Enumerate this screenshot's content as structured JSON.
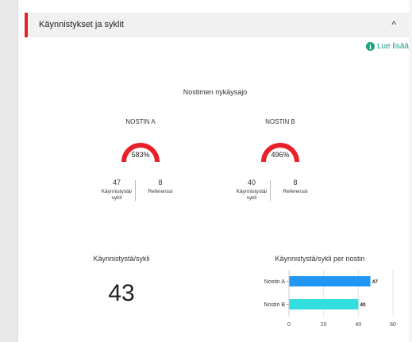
{
  "header": {
    "title": "Käynnistykset ja syklit",
    "chevron": "^"
  },
  "read_more": {
    "icon_glyph": "i",
    "label": "Lue lisää"
  },
  "section_title": "Nostimen nykäysajo",
  "hoists": [
    {
      "name": "NOSTIN A",
      "gauge_value": "583%",
      "gauge_fill": 1.0,
      "starts_value": "47",
      "starts_label_1": "Käynnistystä/",
      "starts_label_2": "sykli",
      "ref_value": "8",
      "ref_label": "Referenssi"
    },
    {
      "name": "NOSTIN B",
      "gauge_value": "496%",
      "gauge_fill": 1.0,
      "starts_value": "40",
      "starts_label_1": "Käynnistystä/",
      "starts_label_2": "sykli",
      "ref_value": "8",
      "ref_label": "Referenssi"
    }
  ],
  "summary": {
    "title": "Käynnistystä/sykli",
    "value": "43"
  },
  "colors": {
    "accent": "#e8202a",
    "gauge": "#e8202a",
    "bar_a": "#2196f3",
    "bar_b": "#33dede",
    "link": "#169d8a"
  },
  "chart_data": {
    "type": "bar",
    "orientation": "horizontal",
    "title": "Käynnistystä/sykli per nostin",
    "categories": [
      "Nostin A",
      "Nostin B"
    ],
    "values": [
      47,
      40
    ],
    "data_labels": [
      "47",
      "40"
    ],
    "xlim": [
      0,
      60
    ],
    "xticks": [
      "0",
      "20",
      "40",
      "60"
    ],
    "grid": true
  }
}
